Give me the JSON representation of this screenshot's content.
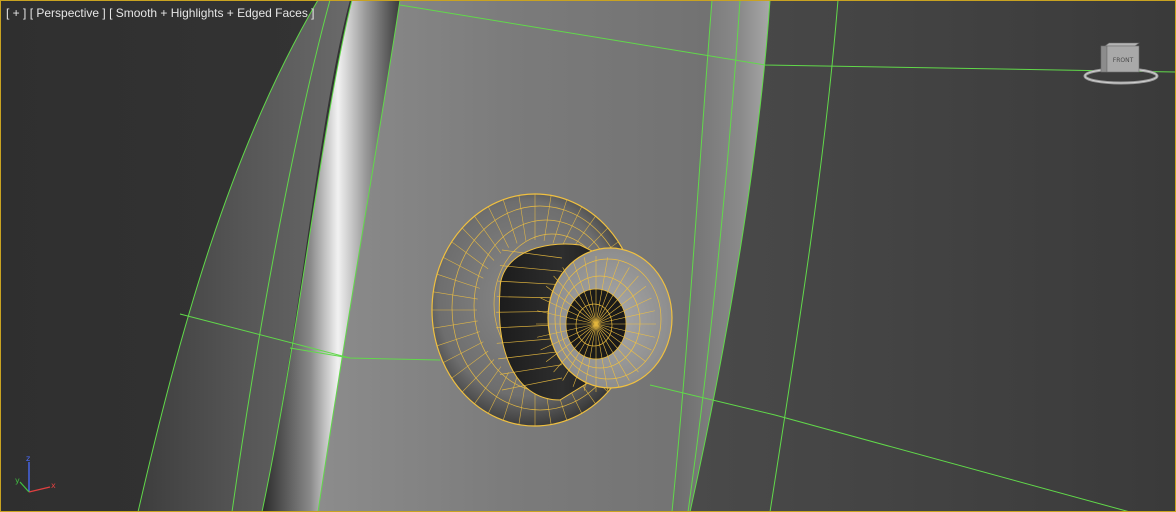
{
  "viewport": {
    "label_parts": [
      "[ + ]",
      "[ Perspective ]",
      "[ Smooth + Highlights + Edged Faces ]"
    ],
    "border_color": "#c9a321",
    "edge_color": "#61d94a",
    "selection_color": "#f0c040"
  },
  "viewcube": {
    "face_label": "FRONT",
    "icon": "viewcube-icon"
  },
  "axis_tripod": {
    "x_label": "x",
    "y_label": "y",
    "z_label": "z"
  }
}
